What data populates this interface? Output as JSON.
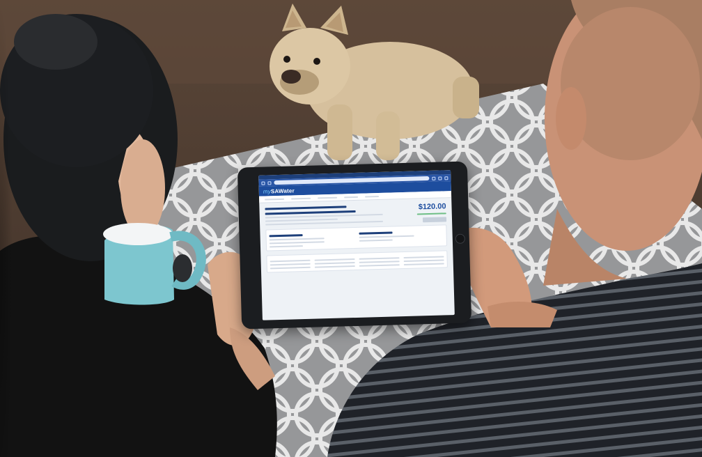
{
  "screen": {
    "brand": {
      "prefix": "my",
      "name": "SAWater"
    },
    "balance": {
      "amount": "$120.00"
    }
  },
  "colors": {
    "wall": "#4a3a30",
    "rug": "#8e8f91",
    "rug_pattern": "#e6e6e6",
    "brand_blue": "#1d4d9e",
    "mug": "#7dc6cf",
    "striped_shirt_dark": "#22252b",
    "striped_shirt_light": "#5a6068",
    "black_top": "#121212",
    "dog": "#d8c3a1"
  },
  "icons": [
    "tablet-home-button-icon"
  ]
}
